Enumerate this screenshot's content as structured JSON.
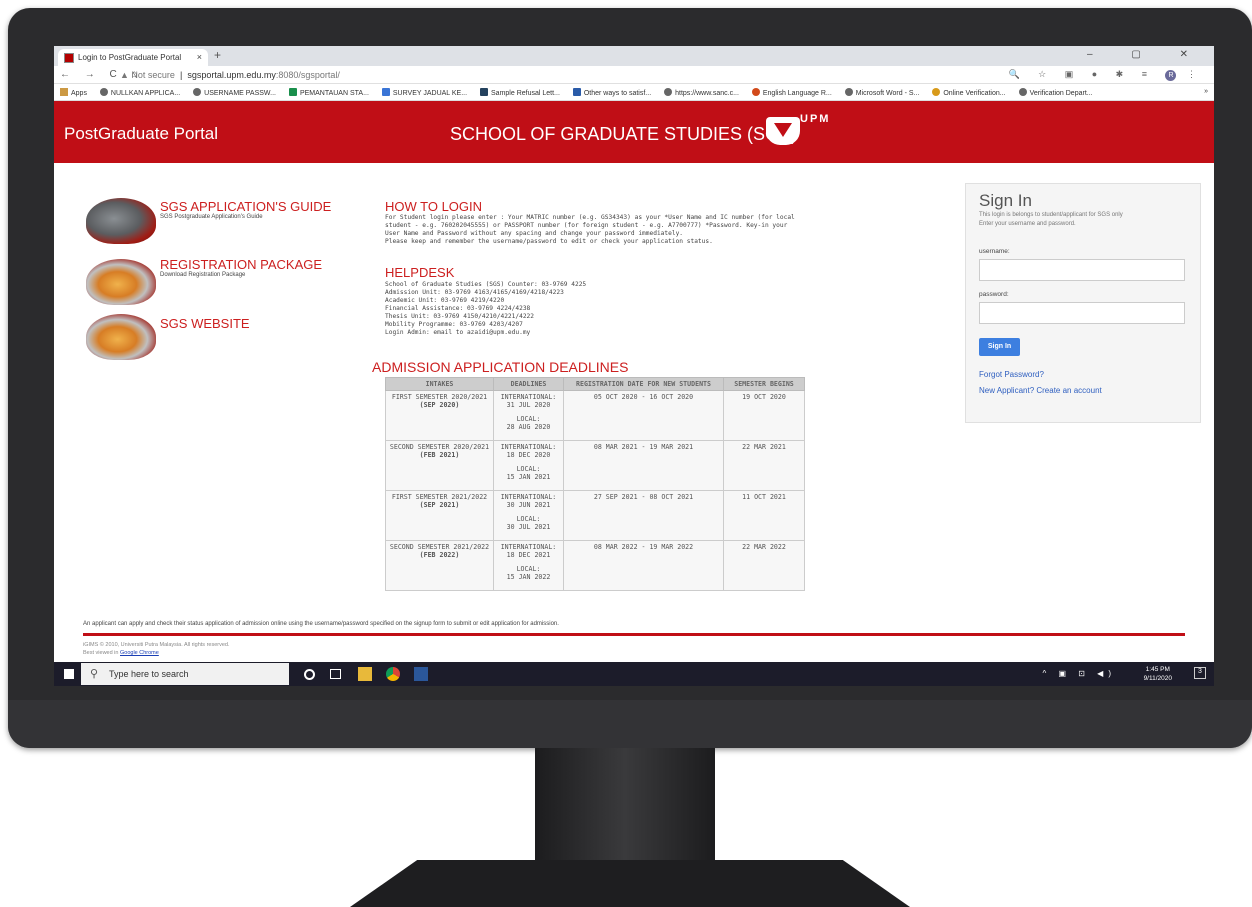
{
  "browser": {
    "tab_title": "Login to PostGraduate Portal",
    "tab_close": "×",
    "new_tab": "+",
    "window_controls": "– ▢ ✕",
    "nav_icons": "← → C ⌂",
    "security": "▲ Not secure",
    "url_host": "sgsportal.upm.edu.my",
    "url_path": ":8080/sgsportal/",
    "ext_icons": "🔍 ☆ ▣ ● ✱ ≡",
    "avatar_letter": "R",
    "menu": "⋮",
    "bookmarks": [
      "Apps",
      "NULLKAN APPLICA...",
      "USERNAME PASSW...",
      "PEMANTAUAN STA...",
      "SURVEY JADUAL KE...",
      "Sample Refusal Lett...",
      "Other ways to satisf...",
      "https://www.sanc.c...",
      "English Language R...",
      "Microsoft Word - S...",
      "Online Verification...",
      "Verification Depart..."
    ],
    "more_bookmarks": "»"
  },
  "header": {
    "brand": "PostGraduate Portal",
    "school": "SCHOOL OF GRADUATE STUDIES (SGS)",
    "logo_text": "UPM",
    "colors": {
      "accent": "#c00e16",
      "link": "#cc1f1f",
      "button": "#3d7fe0"
    }
  },
  "left_links": [
    {
      "title": "SGS APPLICATION'S GUIDE",
      "sub": "SGS Postgraduate Application's Guide"
    },
    {
      "title": "REGISTRATION PACKAGE",
      "sub": "Download Registration Package"
    },
    {
      "title": "SGS WEBSITE",
      "sub": ""
    }
  ],
  "how_to_login": {
    "title": "HOW TO LOGIN",
    "lines": [
      "For Student login please enter : Your MATRIC number (e.g. GS34343) as your *User Name and IC number (for local",
      "student - e.g. 760202045555) or PASSPORT number (for foreign student - e.g. A7700777) *Password. Key-in your",
      "User Name and Password without any spacing and change your password immediately.",
      "Please keep and remember the username/password to edit or check your application status."
    ]
  },
  "helpdesk": {
    "title": "HELPDESK",
    "lines": [
      "School of Graduate Studies (SGS) Counter: 03-9769 4225",
      "Admission Unit: 03-9769 4163/4165/4169/4218/4223",
      "Academic Unit: 03-9769 4219/4220",
      "Financial Assistance: 03-9769 4224/4238",
      "Thesis Unit: 03-9769 4150/4210/4221/4222",
      "Mobility Programme: 03-9769 4203/4207",
      "Login Admin: email to azaidi@upm.edu.my"
    ]
  },
  "deadlines": {
    "title": "ADMISSION APPLICATION DEADLINES",
    "headers": [
      "INTAKES",
      "DEADLINES",
      "REGISTRATION DATE FOR NEW STUDENTS",
      "SEMESTER BEGINS"
    ],
    "rows": [
      {
        "intake": "FIRST SEMESTER 2020/2021",
        "intake_bold": "(SEP 2020)",
        "intl_label": "INTERNATIONAL:",
        "intl_date": "31 JUL 2020",
        "local_label": "LOCAL:",
        "local_date": "28 AUG 2020",
        "registration": "05 OCT 2020 - 16 OCT 2020",
        "begins": "19 OCT 2020"
      },
      {
        "intake": "SECOND SEMESTER 2020/2021",
        "intake_bold": "(FEB 2021)",
        "intl_label": "INTERNATIONAL:",
        "intl_date": "18 DEC 2020",
        "local_label": "LOCAL:",
        "local_date": "15 JAN 2021",
        "registration": "08 MAR 2021 - 19 MAR 2021",
        "begins": "22 MAR 2021"
      },
      {
        "intake": "FIRST SEMESTER 2021/2022",
        "intake_bold": "(SEP 2021)",
        "intl_label": "INTERNATIONAL:",
        "intl_date": "30 JUN 2021",
        "local_label": "LOCAL:",
        "local_date": "30 JUL 2021",
        "registration": "27 SEP 2021 - 08 OCT 2021",
        "begins": "11 OCT 2021"
      },
      {
        "intake": "SECOND SEMESTER 2021/2022",
        "intake_bold": "(FEB 2022)",
        "intl_label": "INTERNATIONAL:",
        "intl_date": "18 DEC 2021",
        "local_label": "LOCAL:",
        "local_date": "15 JAN 2022",
        "registration": "08 MAR 2022 - 19 MAR 2022",
        "begins": "22 MAR 2022"
      }
    ]
  },
  "signin": {
    "title": "Sign In",
    "desc1": "This login is belongs to student/applicant for SGS only",
    "desc2": "Enter your username and password.",
    "username_label": "username:",
    "password_label": "password:",
    "username_value": "",
    "password_value": "",
    "button": "Sign In",
    "forgot": "Forgot Password?",
    "new_applicant": "New Applicant? Create an account"
  },
  "footer": {
    "note": "An applicant can apply and check their status application of admission online using the username/password specified on the signup form to submit or edit application for admission.",
    "copyright": "iGIMS © 2010, Universiti Putra Malaysia. All rights reserved.",
    "best_viewed": "Best viewed in",
    "browser_link": "Google Chrome"
  },
  "taskbar": {
    "search_placeholder": "Type here to search",
    "tray_icons": "^ ▣ ⊡ ◀)",
    "time": "1:45 PM",
    "date": "9/11/2020",
    "notifications": "3"
  }
}
